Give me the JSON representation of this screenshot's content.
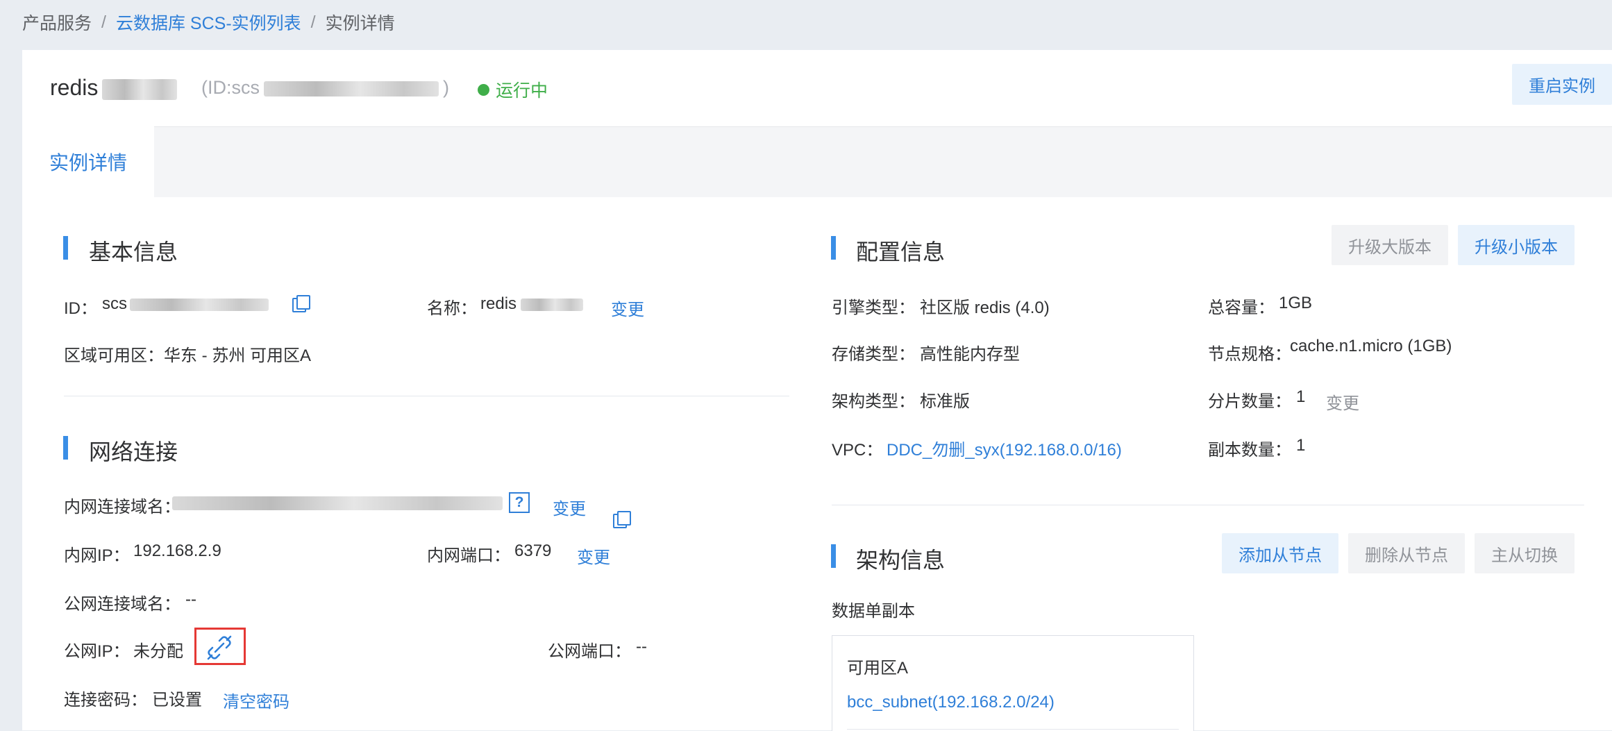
{
  "breadcrumb": {
    "item1": "产品服务",
    "sep": "/",
    "item2": "云数据库 SCS-实例列表",
    "item3": "实例详情"
  },
  "header": {
    "title_prefix": "redis",
    "id_prefix": "(ID:scs",
    "id_suffix": ")",
    "status": "运行中",
    "restart_label": "重启实例"
  },
  "tabs": {
    "detail": "实例详情"
  },
  "basic": {
    "title": "基本信息",
    "id_label": "ID：",
    "id_value_prefix": "scs",
    "name_label": "名称：",
    "name_value_prefix": "redis",
    "name_change": "变更",
    "zone_label": "区域可用区：",
    "zone_value": "华东 - 苏州 可用区A"
  },
  "network": {
    "title": "网络连接",
    "inner_domain_label": "内网连接域名：",
    "help": "?",
    "inner_domain_change": "变更",
    "inner_ip_label": "内网IP：",
    "inner_ip_value": "192.168.2.9",
    "inner_port_label": "内网端口：",
    "inner_port_value": "6379",
    "inner_port_change": "变更",
    "public_domain_label": "公网连接域名：",
    "public_domain_value": "--",
    "public_ip_label": "公网IP：",
    "public_ip_value": "未分配",
    "public_port_label": "公网端口：",
    "public_port_value": "--",
    "password_label": "连接密码：",
    "password_value": "已设置",
    "password_clear": "清空密码"
  },
  "config": {
    "title": "配置信息",
    "upgrade_major": "升级大版本",
    "upgrade_minor": "升级小版本",
    "engine_label": "引擎类型：",
    "engine_value": "社区版 redis (4.0)",
    "capacity_label": "总容量：",
    "capacity_value": "1GB",
    "storage_label": "存储类型：",
    "storage_value": "高性能内存型",
    "node_spec_label": "节点规格：",
    "node_spec_value": "cache.n1.micro (1GB)",
    "arch_label": "架构类型：",
    "arch_value": "标准版",
    "shard_label": "分片数量：",
    "shard_value": "1",
    "shard_change": "变更",
    "vpc_label": "VPC：",
    "vpc_value": "DDC_勿删_syx(192.168.0.0/16)",
    "replica_label": "副本数量：",
    "replica_value": "1"
  },
  "architecture": {
    "title": "架构信息",
    "add_slave": "添加从节点",
    "delete_slave": "删除从节点",
    "switch": "主从切换",
    "mode": "数据单副本",
    "zone_name": "可用区A",
    "subnet": "bcc_subnet(192.168.2.0/24)"
  }
}
